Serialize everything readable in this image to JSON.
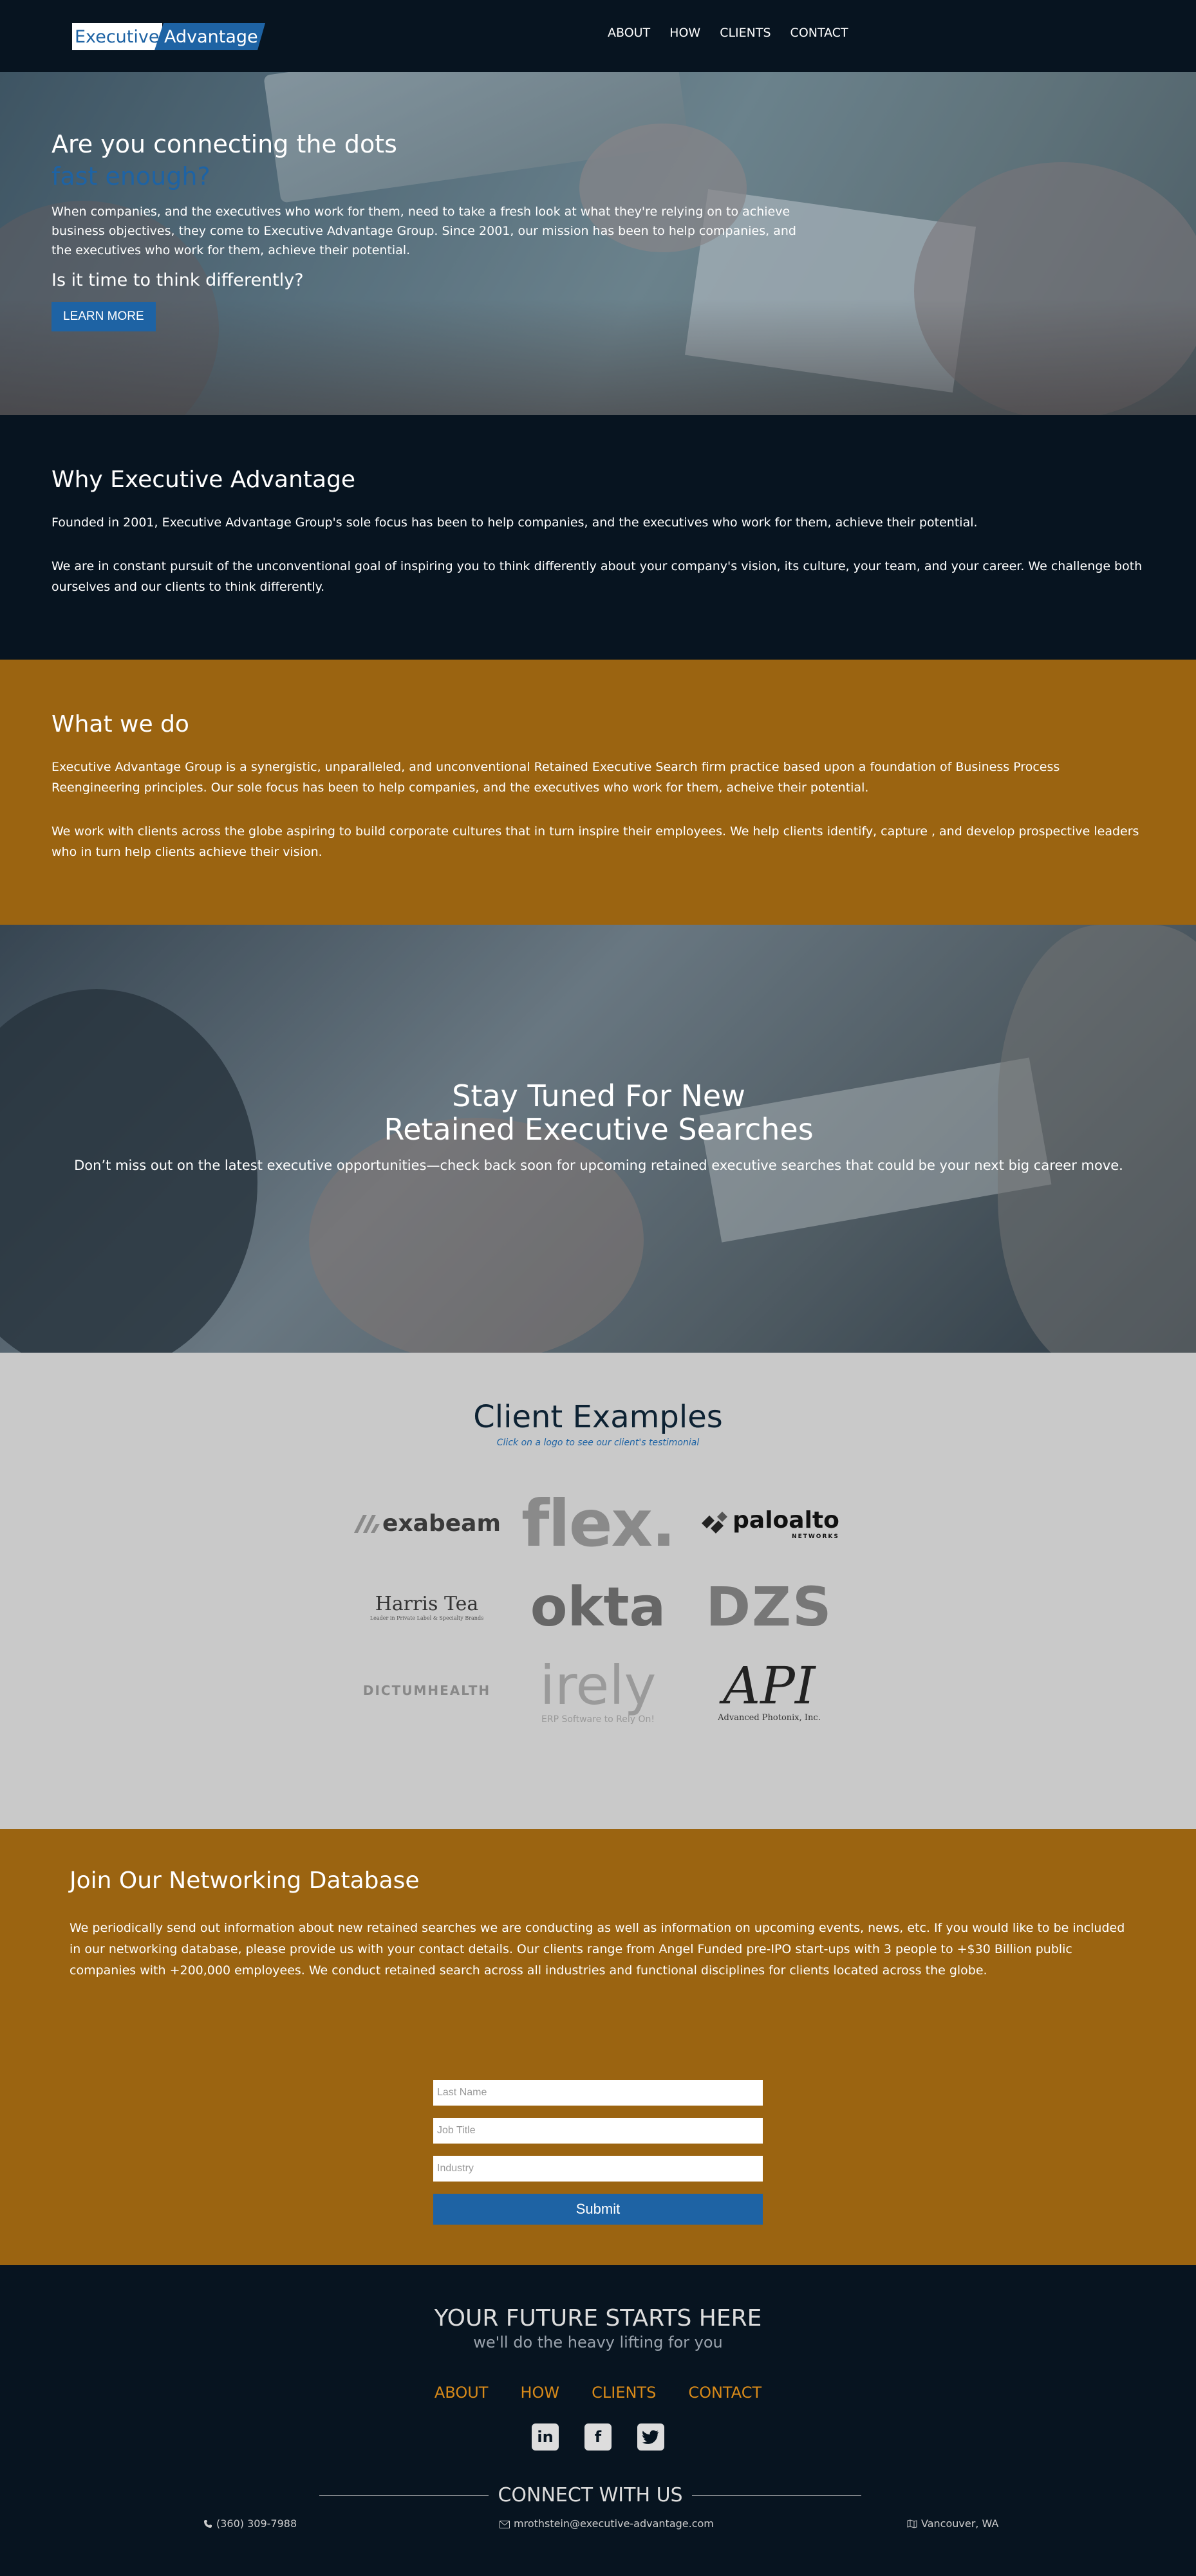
{
  "brand": {
    "name_part1": "Executive",
    "name_part2": "Advantage"
  },
  "nav": {
    "items": [
      "ABOUT",
      "HOW",
      "CLIENTS",
      "CONTACT"
    ]
  },
  "hero": {
    "title": "Are you connecting the dots",
    "title_highlight": "fast enough?",
    "body": "When companies, and the executives who work for them, need to take a fresh look at what they're relying on to achieve business objectives, they come to Executive Advantage Group. Since 2001, our mission has been to help companies, and the executives who work for them, achieve their potential.",
    "subheading": "Is it time to think differently?",
    "cta": "LEARN MORE"
  },
  "why": {
    "title": "Why Executive Advantage",
    "p1": "Founded in 2001, Executive Advantage Group's sole focus has been to help companies, and the executives who work for them, achieve their potential.",
    "p2": "We are in constant pursuit of the unconventional goal of inspiring you to think differently about your company's vision, its culture, your team, and your career. We challenge both ourselves and our clients to think differently."
  },
  "what": {
    "title": "What we do",
    "p1": "Executive Advantage Group is a synergistic, unparalleled, and unconventional Retained Executive Search firm practice based upon a foundation of Business Process Reengineering principles. Our sole focus has been to help companies, and the executives who work for them, acheive their potential.",
    "p2": "We work with clients across the globe aspiring to build corporate cultures that in turn inspire their employees. We help clients identify, capture , and develop prospective leaders who in turn help clients achieve their vision."
  },
  "tuned": {
    "line1": "Stay Tuned For New",
    "line2": "Retained Executive Searches",
    "body": "Don’t miss out on the latest executive opportunities—check back soon for upcoming retained executive searches that could be your next big career move."
  },
  "clients": {
    "title": "Client Examples",
    "hint": "Click on a logo to see our client's testimonial",
    "logos": {
      "exabeam": "exabeam",
      "flex": "flex.",
      "paloalto": "paloalto",
      "paloalto_sub": "NETWORKS",
      "harris": "Harris Tea",
      "harris_sub": "Leader in Private Label & Specialty Brands",
      "okta": "okta",
      "dzs": "DZS",
      "dictum": "DICTUMHEALTH",
      "irely": "irely",
      "irely_sub": "ERP Software to Rely On!",
      "api": "API",
      "api_sub": "Advanced Photonix, Inc."
    }
  },
  "network": {
    "title": "Join Our Networking Database",
    "body": "We periodically send out information about new retained searches we are conducting as well as information on upcoming events, news, etc. If you would like to be included in our networking database, please provide us with your contact details. Our clients range from Angel Funded pre-IPO start-ups with 3 people to +$30 Billion public companies with +200,000 employees. We conduct retained search across all industries and functional disciplines for clients located across the globe.",
    "fields": {
      "last_name": "Last Name",
      "job_title": "Job Title",
      "industry": "Industry"
    },
    "submit": "Submit"
  },
  "footer": {
    "title": "YOUR FUTURE STARTS HERE",
    "subtitle": "we'll do the heavy lifting for you",
    "links": [
      "ABOUT",
      "HOW",
      "CLIENTS",
      "CONTACT"
    ],
    "connect": "CONNECT WITH US",
    "phone": "(360) 309-7988",
    "email": "mrothstein@executive-advantage.com",
    "location": "Vancouver, WA",
    "accent": "#d88a19"
  },
  "colors": {
    "navy": "#071420",
    "gold": "#9b6411",
    "blue": "#1e63a4",
    "grey": "#c9c9c9"
  }
}
